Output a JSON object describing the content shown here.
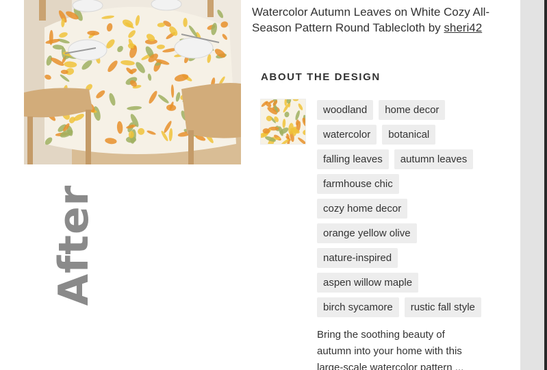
{
  "product": {
    "title": "Watercolor Autumn Leaves on White Cozy All-Season Pattern Round Tablecloth by",
    "author": "sheri42"
  },
  "watermark": {
    "text": "After"
  },
  "about": {
    "heading": "ABOUT THE DESIGN",
    "tag_rows": [
      [
        "woodland",
        "home decor"
      ],
      [
        "watercolor",
        "botanical"
      ],
      [
        "falling leaves",
        "autumn leaves"
      ],
      [
        "farmhouse chic"
      ],
      [
        "cozy home decor"
      ],
      [
        "orange yellow olive"
      ],
      [
        "nature-inspired"
      ],
      [
        "aspen willow maple"
      ],
      [
        "birch sycamore",
        "rustic fall style"
      ]
    ],
    "description": "Bring the soothing beauty of autumn into your home with this large-scale watercolor pattern ..."
  },
  "colors": {
    "leaf_orange": "#e8902c",
    "leaf_yellow": "#f0c33a",
    "leaf_olive": "#9fb060",
    "tag_bg": "#ededed",
    "wood": "#d9b88c"
  }
}
